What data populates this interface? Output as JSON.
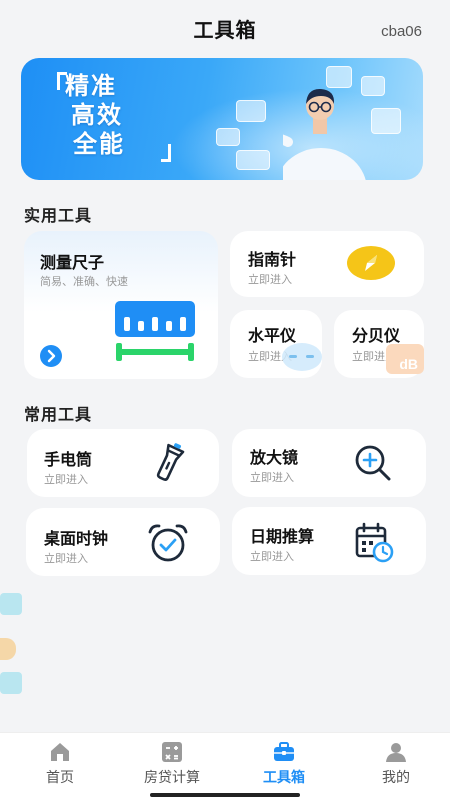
{
  "header": {
    "title": "工具箱",
    "user": "cba06"
  },
  "banner": {
    "line1": "精准",
    "line2": "高效",
    "line3": "全能"
  },
  "sections": {
    "practical": "实用工具",
    "common": "常用工具"
  },
  "enter_label": "立即进入",
  "practical_tools": {
    "ruler": {
      "title": "测量尺子",
      "desc": "简易、准确、快速"
    },
    "compass": {
      "title": "指南针",
      "sub": "立即进入"
    },
    "level": {
      "title": "水平仪",
      "sub": "立即进入"
    },
    "decibel": {
      "title": "分贝仪",
      "sub": "立即进入",
      "badge": "dB"
    }
  },
  "common_tools": {
    "flashlight": {
      "title": "手电筒",
      "sub": "立即进入"
    },
    "magnifier": {
      "title": "放大镜",
      "sub": "立即进入"
    },
    "clock": {
      "title": "桌面时钟",
      "sub": "立即进入"
    },
    "date_calc": {
      "title": "日期推算",
      "sub": "立即进入"
    }
  },
  "tabbar": {
    "items": [
      {
        "label": "首页",
        "icon": "home-icon"
      },
      {
        "label": "房贷计算",
        "icon": "calculator-icon"
      },
      {
        "label": "工具箱",
        "icon": "toolbox-icon"
      },
      {
        "label": "我的",
        "icon": "profile-icon"
      }
    ],
    "active": 2
  },
  "colors": {
    "accent": "#1f8ef5",
    "compass": "#f5c518",
    "ruler": "#1f8ef5",
    "ruler_base": "#2bd46a",
    "decibel": "#f5a25c"
  }
}
